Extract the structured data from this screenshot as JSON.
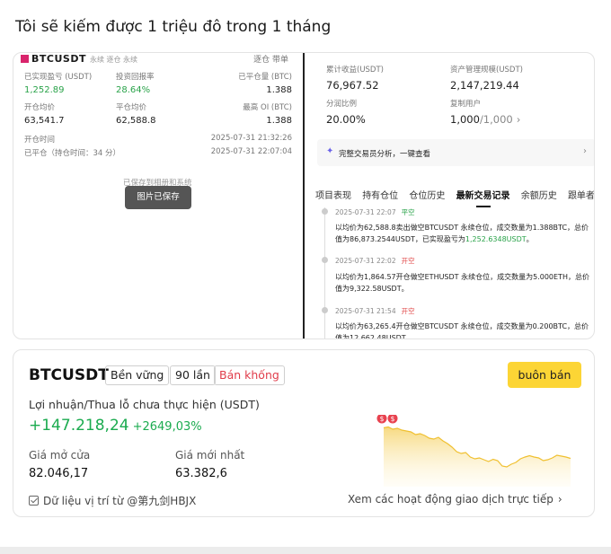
{
  "page_title": "Tôi sẽ kiếm được 1 triệu đô trong 1 tháng",
  "screenshot": {
    "left": {
      "symbol": "BTCUSDT",
      "meta": "永续  逐仓 永续",
      "right_label": "逐仓 带单",
      "stats": [
        {
          "label": "已实现盈亏 (USDT)",
          "value": "1,252.89",
          "color": "green"
        },
        {
          "label": "投资回报率",
          "value": "28.64%",
          "color": "green"
        },
        {
          "label": "已平仓量 (BTC)",
          "value": "1.388",
          "color": "default"
        },
        {
          "label": "开仓均价",
          "value": "63,541.7",
          "color": "default"
        },
        {
          "label": "平仓均价",
          "value": "62,588.8",
          "color": "default"
        },
        {
          "label": "最高 OI (BTC)",
          "value": "1.388",
          "color": "default"
        }
      ],
      "open_time_label": "开仓时间",
      "open_time_value": "2025-07-31 21:32:26",
      "close_time_label": "已平仓（持仓时间：34 分）",
      "close_time_value": "2025-07-31 22:07:04",
      "saved_ghost": "已保存到相册和系统",
      "toast": "图片已保存"
    },
    "right": {
      "stats": [
        {
          "label": "累计收益(USDT)",
          "value": "76,967.52"
        },
        {
          "label": "资产管理规模(USDT)",
          "value": "2,147,219.44"
        },
        {
          "label": "分润比例",
          "value": "20.00%"
        },
        {
          "label": "复制用户",
          "value": "1,000",
          "sub": "/1,000",
          "chevron": "›"
        }
      ],
      "analysis_text": "完整交易员分析，一键查看",
      "tabs": [
        "项目表现",
        "持有仓位",
        "仓位历史",
        "最新交易记录",
        "余额历史",
        "跟单者"
      ],
      "active_tab": "最新交易记录",
      "timeline": [
        {
          "time": "2025-07-31 22:07",
          "tag": "平空",
          "tag_type": "close",
          "text_pre": "以均价为62,588.8卖出做空BTCUSDT 永续仓位，成交数量为1.388BTC，总价值为86,873.2544USDT，已实现盈亏为",
          "highlight": "1,252.6348USDT",
          "text_post": "。"
        },
        {
          "time": "2025-07-31 22:02",
          "tag": "开空",
          "tag_type": "open",
          "text_pre": "以均价为1,864.57开仓做空ETHUSDT 永续仓位，成交数量为5.000ETH，总价值为9,322.58USDT。",
          "highlight": "",
          "text_post": ""
        },
        {
          "time": "2025-07-31 21:54",
          "tag": "开空",
          "tag_type": "open",
          "text_pre": "以均价为63,265.4开仓做空BTCUSDT 永续仓位，成交数量为0.200BTC，总价值为12,662.48USDT",
          "highlight": "",
          "text_post": ""
        }
      ]
    }
  },
  "trade_card": {
    "pair": "BTCUSDT",
    "badges": [
      "Bền vững",
      "90 lần",
      "Bán khống"
    ],
    "trade_button": "buôn bán",
    "pnl_label": "Lợi nhuận/Thua lỗ chưa thực hiện (USDT)",
    "pnl_value": "+147.218,24",
    "pnl_pct": "+2649,03%",
    "open_price_label": "Giá mở cửa",
    "open_price_value": "82.046,17",
    "last_price_label": "Giá mới nhất",
    "last_price_value": "63.382,6",
    "footer_left": "Dữ liệu vị trí từ @第九剑HBJX",
    "footer_right": "Xem các hoạt động giao dịch trực tiếp",
    "chart_marker_glyph": "$",
    "chart_series": [
      0.95,
      0.97,
      0.92,
      0.94,
      0.9,
      0.88,
      0.86,
      0.8,
      0.82,
      0.78,
      0.72,
      0.7,
      0.74,
      0.66,
      0.6,
      0.52,
      0.42,
      0.38,
      0.4,
      0.3,
      0.26,
      0.28,
      0.24,
      0.2,
      0.25,
      0.22,
      0.1,
      0.08,
      0.14,
      0.18,
      0.26,
      0.3,
      0.33,
      0.3,
      0.28,
      0.22,
      0.24,
      0.28,
      0.34,
      0.32,
      0.3,
      0.27
    ],
    "colors": {
      "accent": "#fcd535",
      "up": "#1bab4f",
      "short": "#e03c4a",
      "marker": "#e8424f"
    }
  }
}
